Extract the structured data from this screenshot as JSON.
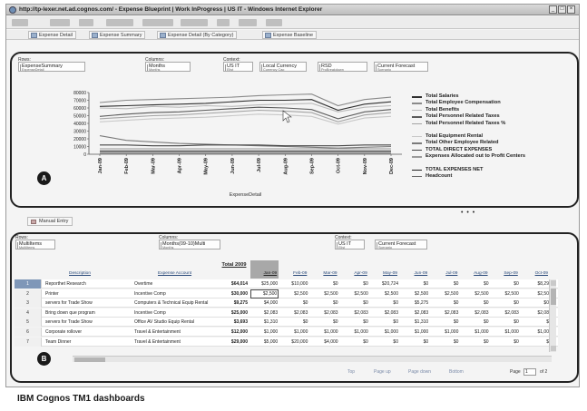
{
  "window": {
    "title": "http://tp-lexer.net.ad.cognos.com/ - Expense Blueprint | Work InProgress | US IT - Windows Internet Explorer",
    "controls": [
      "_",
      "□",
      "×"
    ]
  },
  "tabs": [
    "Expense Detail",
    "Expense Summary",
    "Expense Detail (By Category)",
    "Expense Baseline"
  ],
  "top_view": {
    "rows": {
      "label": "Rows:",
      "value": "ExpenseSummary",
      "sub": "ExpenseDetail"
    },
    "columns": {
      "label": "Columns:",
      "value": "Months",
      "sub": "Months"
    },
    "context_label": "Context:",
    "context": [
      {
        "value": "US IT",
        "sub": "Elist"
      },
      {
        "value": "Local Currency",
        "sub": "Currency Cao"
      },
      {
        "value": "RSD",
        "sub": "ProBreakdown"
      },
      {
        "value": "Current Forecast",
        "sub": "Scenario"
      }
    ]
  },
  "chart_data": {
    "type": "line",
    "categories": [
      "Jan-09",
      "Feb-09",
      "Mar-09",
      "Apr-09",
      "May-09",
      "Jun-09",
      "Jul-09",
      "Aug-09",
      "Sep-09",
      "Oct-09",
      "Nov-09",
      "Dec-09"
    ],
    "ylim": [
      0,
      80000
    ],
    "yticks": [
      0,
      10000,
      20000,
      30000,
      40000,
      50000,
      60000,
      70000,
      80000
    ],
    "xlabel": "ExpenseDetail",
    "grid": false,
    "legend_position": "right",
    "series": [
      {
        "name": "Total Salaries",
        "color": "#2f2f2f",
        "values": [
          62000,
          63000,
          64000,
          65000,
          66000,
          68000,
          70000,
          70000,
          71000,
          57000,
          65000,
          68000
        ]
      },
      {
        "name": "Total Employee Compensation",
        "color": "#8a8a8a",
        "values": [
          67000,
          70000,
          71000,
          72000,
          73000,
          74000,
          76000,
          77000,
          78000,
          63000,
          71000,
          74000
        ]
      },
      {
        "name": "Total Benefits",
        "color": "#b9b9b9",
        "values": [
          60000,
          59000,
          62000,
          61000,
          63000,
          62000,
          64000,
          65000,
          66000,
          55000,
          61000,
          63000
        ]
      },
      {
        "name": "Total Personnel Related Taxes",
        "color": "#5a5a5a",
        "values": [
          49000,
          52000,
          54000,
          55000,
          57000,
          59000,
          61000,
          60000,
          58000,
          46000,
          55000,
          58000
        ]
      },
      {
        "name": "Total Personnel Related Taxes %",
        "color": "#a3a3a3",
        "values": [
          46000,
          48000,
          50000,
          51000,
          53000,
          55000,
          57000,
          56000,
          54000,
          42000,
          51000,
          54000
        ]
      },
      {
        "name": "Total Equipment Rental",
        "color": "#c8c8c8",
        "values": [
          42000,
          44000,
          46000,
          47000,
          48000,
          50000,
          52000,
          51000,
          49000,
          39000,
          47000,
          49000
        ]
      },
      {
        "name": "Total Other Employee Related",
        "color": "#7a7a7a",
        "values": [
          24000,
          18000,
          16000,
          14000,
          13000,
          12000,
          11000,
          10000,
          9000,
          8000,
          9000,
          10000
        ]
      },
      {
        "name": "TOTAL DIRECT EXPENSES",
        "color": "#444444",
        "values": [
          12000,
          12000,
          11000,
          11000,
          12000,
          12000,
          12000,
          11000,
          11000,
          11000,
          12000,
          12000
        ]
      },
      {
        "name": "Expenses Allocated out to Profit Centers",
        "color": "#9a9a9a",
        "values": [
          7000,
          7000,
          7000,
          7000,
          7000,
          7000,
          7000,
          7000,
          7000,
          7000,
          7000,
          7000
        ]
      },
      {
        "name": "TOTAL EXPENSES NET",
        "color": "#1f1f1f",
        "values": [
          4000,
          4000,
          4000,
          4000,
          4000,
          4000,
          4000,
          4000,
          4000,
          4000,
          4000,
          4000
        ]
      },
      {
        "name": "Headcount",
        "color": "#666666",
        "values": [
          1500,
          1500,
          1500,
          1500,
          1500,
          1500,
          1500,
          1500,
          1500,
          1500,
          1500,
          1500
        ]
      }
    ]
  },
  "legend_more": "• • •",
  "markers": {
    "a": "A",
    "b": "B"
  },
  "manual_entry_tab": "Manual Entry",
  "bottom_view": {
    "rows": {
      "label": "Rows:",
      "value": "MultiItems",
      "sub": "MultiItems"
    },
    "columns": {
      "label": "Columns:",
      "value": "Months(09-10)Multi",
      "sub": "Months"
    },
    "context_label": "Context:",
    "context": [
      {
        "value": "US IT",
        "sub": "Elist"
      },
      {
        "value": "Current Forecast",
        "sub": "Scenario"
      }
    ]
  },
  "grid": {
    "headers": {
      "description": "Description",
      "account": "Expense Account",
      "total": "Total 2009",
      "months": [
        "Jan-09",
        "Feb-09",
        "Mar-09",
        "Apr-09",
        "May-09",
        "Jun-09",
        "Jul-09",
        "Aug-09",
        "Sep-09",
        "Oct-09"
      ]
    },
    "rows": [
      {
        "n": "1",
        "desc": "Reporthet Research",
        "acct": "Overtime",
        "total": "$64,014",
        "vals": [
          "$25,000",
          "$10,000",
          "$0",
          "$0",
          "$20,724",
          "$0",
          "$0",
          "$0",
          "$0",
          "$8,29"
        ]
      },
      {
        "n": "2",
        "desc": "Printer",
        "acct": "Incentive Comp",
        "total": "$30,000",
        "vals": [
          "$2,500",
          "$2,500",
          "$2,500",
          "$2,500",
          "$2,500",
          "$2,500",
          "$2,500",
          "$2,500",
          "$2,500",
          "$2,50"
        ]
      },
      {
        "n": "3",
        "desc": "servers for Trade Show",
        "acct": "Computers & Technical Equip Rental",
        "total": "$9,275",
        "vals": [
          "$4,000",
          "$0",
          "$0",
          "$0",
          "$0",
          "$5,275",
          "$0",
          "$0",
          "$0",
          "$0"
        ]
      },
      {
        "n": "4",
        "desc": "Bring down que program",
        "acct": "Incentive Comp",
        "total": "$25,000",
        "vals": [
          "$2,083",
          "$2,083",
          "$2,083",
          "$2,083",
          "$2,083",
          "$2,083",
          "$2,083",
          "$2,083",
          "$2,083",
          "$2,08"
        ]
      },
      {
        "n": "5",
        "desc": "servers for Trade Show",
        "acct": "Office AV Studio Equip Rental",
        "total": "$3,693",
        "vals": [
          "$1,310",
          "$0",
          "$0",
          "$0",
          "$0",
          "$1,310",
          "$0",
          "$0",
          "$0",
          "$"
        ]
      },
      {
        "n": "6",
        "desc": "Corporate rollover",
        "acct": "Travel & Entertainment",
        "total": "$12,000",
        "vals": [
          "$1,000",
          "$1,000",
          "$1,000",
          "$1,000",
          "$1,000",
          "$1,000",
          "$1,000",
          "$1,000",
          "$1,000",
          "$1,00"
        ]
      },
      {
        "n": "7",
        "desc": "Team Dinner",
        "acct": "Travel & Entertainment",
        "total": "$29,000",
        "vals": [
          "$5,000",
          "$20,000",
          "$4,000",
          "$0",
          "$0",
          "$0",
          "$0",
          "$0",
          "$0",
          "$"
        ]
      }
    ]
  },
  "pager": {
    "top": "Top",
    "page_up": "Page up",
    "page_down": "Page down",
    "bottom": "Bottom",
    "page_label": "Page",
    "page_value": "1",
    "of": "of 2"
  },
  "caption": "IBM Cognos TM1 dashboards"
}
